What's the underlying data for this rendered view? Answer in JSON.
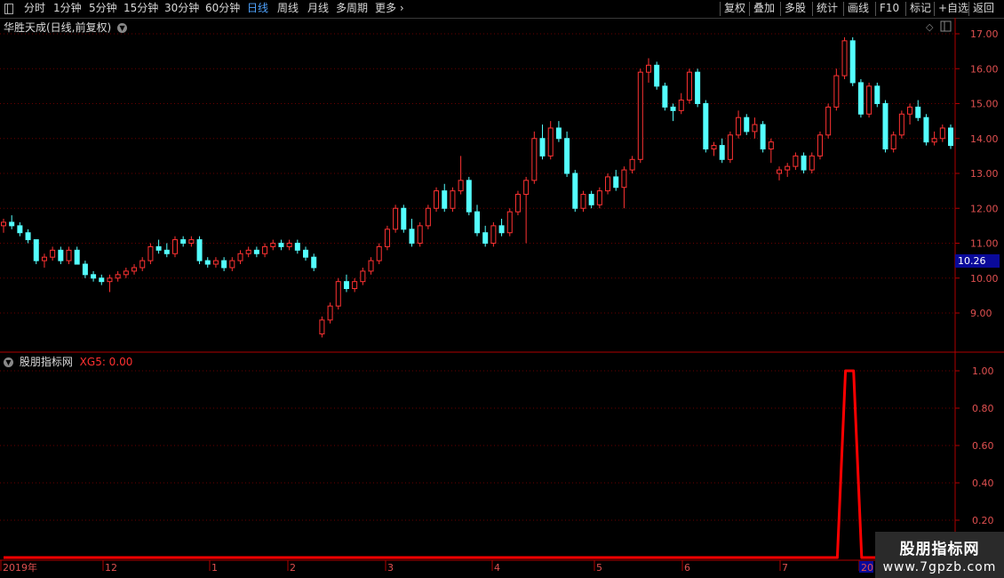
{
  "toolbar": {
    "left_items": [
      "分时",
      "1分钟",
      "5分钟",
      "15分钟",
      "30分钟",
      "60分钟",
      "日线",
      "周线",
      "月线",
      "多周期",
      "更多"
    ],
    "active": "日线",
    "right_items": [
      "复权",
      "叠加",
      "多股",
      "统计",
      "画线",
      "F10",
      "标记",
      "+自选",
      "返回"
    ]
  },
  "main_panel": {
    "title": "华胜天成(日线,前复权)",
    "current_price_label": "10.26",
    "y_ticks": [
      "17.00",
      "16.00",
      "15.00",
      "14.00",
      "13.00",
      "12.00",
      "11.00",
      "10.00",
      "9.00"
    ]
  },
  "indicator_panel": {
    "title": "股朋指标网",
    "series_label": "XG5: 0.00",
    "y_ticks": [
      "1.00",
      "0.80",
      "0.60",
      "0.40",
      "0.20"
    ]
  },
  "date_axis": {
    "labels": [
      "2019年",
      "12",
      "1",
      "2",
      "3",
      "4",
      "5",
      "6",
      "7",
      "20"
    ]
  },
  "watermark": {
    "line1": "股朋指标网",
    "line2": "www.7gpzb.com"
  },
  "chart_data": [
    {
      "type": "candlestick",
      "title": "华胜天成(日线,前复权)",
      "ylim": [
        8.0,
        17.3
      ],
      "last_value": 10.26,
      "ohlc": [
        [
          11.5,
          11.7,
          11.3,
          11.6
        ],
        [
          11.6,
          11.8,
          11.4,
          11.5
        ],
        [
          11.5,
          11.6,
          11.2,
          11.3
        ],
        [
          11.3,
          11.4,
          11.0,
          11.1
        ],
        [
          11.1,
          11.1,
          10.4,
          10.5
        ],
        [
          10.5,
          10.7,
          10.3,
          10.6
        ],
        [
          10.6,
          10.9,
          10.5,
          10.8
        ],
        [
          10.8,
          10.9,
          10.4,
          10.5
        ],
        [
          10.5,
          10.9,
          10.4,
          10.8
        ],
        [
          10.8,
          10.9,
          10.4,
          10.4
        ],
        [
          10.4,
          10.5,
          10.0,
          10.1
        ],
        [
          10.1,
          10.2,
          9.9,
          10.0
        ],
        [
          10.0,
          10.1,
          9.8,
          9.9
        ],
        [
          9.9,
          10.1,
          9.6,
          10.0
        ],
        [
          10.0,
          10.2,
          9.9,
          10.1
        ],
        [
          10.1,
          10.3,
          10.0,
          10.2
        ],
        [
          10.2,
          10.4,
          10.1,
          10.3
        ],
        [
          10.3,
          10.6,
          10.2,
          10.5
        ],
        [
          10.5,
          11.0,
          10.4,
          10.9
        ],
        [
          10.9,
          11.1,
          10.7,
          10.8
        ],
        [
          10.8,
          11.0,
          10.6,
          10.7
        ],
        [
          10.7,
          11.2,
          10.6,
          11.1
        ],
        [
          11.1,
          11.2,
          10.9,
          11.0
        ],
        [
          11.0,
          11.2,
          10.9,
          11.1
        ],
        [
          11.1,
          11.2,
          10.4,
          10.5
        ],
        [
          10.5,
          10.6,
          10.3,
          10.4
        ],
        [
          10.4,
          10.6,
          10.3,
          10.5
        ],
        [
          10.5,
          10.6,
          10.2,
          10.3
        ],
        [
          10.3,
          10.6,
          10.2,
          10.5
        ],
        [
          10.5,
          10.8,
          10.4,
          10.7
        ],
        [
          10.7,
          10.9,
          10.6,
          10.8
        ],
        [
          10.8,
          10.9,
          10.6,
          10.7
        ],
        [
          10.7,
          11.0,
          10.6,
          10.9
        ],
        [
          10.9,
          11.1,
          10.8,
          11.0
        ],
        [
          11.0,
          11.1,
          10.8,
          10.9
        ],
        [
          10.9,
          11.1,
          10.8,
          11.0
        ],
        [
          11.0,
          11.1,
          10.7,
          10.8
        ],
        [
          10.8,
          10.9,
          10.5,
          10.6
        ],
        [
          10.6,
          10.7,
          10.2,
          10.3
        ],
        [
          8.4,
          8.9,
          8.3,
          8.8
        ],
        [
          8.8,
          9.3,
          8.7,
          9.2
        ],
        [
          9.2,
          10.0,
          9.1,
          9.9
        ],
        [
          9.9,
          10.1,
          9.6,
          9.7
        ],
        [
          9.7,
          10.0,
          9.6,
          9.9
        ],
        [
          9.9,
          10.3,
          9.8,
          10.2
        ],
        [
          10.2,
          10.6,
          10.1,
          10.5
        ],
        [
          10.5,
          11.0,
          10.4,
          10.9
        ],
        [
          10.9,
          11.5,
          10.8,
          11.4
        ],
        [
          11.4,
          12.1,
          11.3,
          12.0
        ],
        [
          12.0,
          12.1,
          11.3,
          11.4
        ],
        [
          11.4,
          11.7,
          10.9,
          11.0
        ],
        [
          11.0,
          11.6,
          10.9,
          11.5
        ],
        [
          11.5,
          12.1,
          11.4,
          12.0
        ],
        [
          12.0,
          12.6,
          11.9,
          12.5
        ],
        [
          12.5,
          12.7,
          11.9,
          12.0
        ],
        [
          12.0,
          12.6,
          11.9,
          12.5
        ],
        [
          12.5,
          13.5,
          12.4,
          12.8
        ],
        [
          12.8,
          12.9,
          11.8,
          11.9
        ],
        [
          11.9,
          12.1,
          11.2,
          11.3
        ],
        [
          11.3,
          11.5,
          10.9,
          11.0
        ],
        [
          11.0,
          11.6,
          10.9,
          11.5
        ],
        [
          11.5,
          11.7,
          11.2,
          11.3
        ],
        [
          11.3,
          12.0,
          11.2,
          11.9
        ],
        [
          11.9,
          12.5,
          11.8,
          12.4
        ],
        [
          12.4,
          12.9,
          11.0,
          12.8
        ],
        [
          12.8,
          14.2,
          12.7,
          14.0
        ],
        [
          14.0,
          14.4,
          13.4,
          13.5
        ],
        [
          13.5,
          14.5,
          13.4,
          14.3
        ],
        [
          14.3,
          14.5,
          13.9,
          14.0
        ],
        [
          14.0,
          14.2,
          12.9,
          13.0
        ],
        [
          13.0,
          13.1,
          11.9,
          12.0
        ],
        [
          12.0,
          12.5,
          11.9,
          12.4
        ],
        [
          12.4,
          12.5,
          12.0,
          12.1
        ],
        [
          12.1,
          12.6,
          12.0,
          12.5
        ],
        [
          12.5,
          13.0,
          12.4,
          12.9
        ],
        [
          12.9,
          13.1,
          12.5,
          12.6
        ],
        [
          12.6,
          13.2,
          12.0,
          13.1
        ],
        [
          13.1,
          13.5,
          13.0,
          13.4
        ],
        [
          13.4,
          16.0,
          13.3,
          15.9
        ],
        [
          15.9,
          16.3,
          15.6,
          16.1
        ],
        [
          16.1,
          16.2,
          15.4,
          15.5
        ],
        [
          15.5,
          15.6,
          14.8,
          14.9
        ],
        [
          14.9,
          15.0,
          14.5,
          14.8
        ],
        [
          14.8,
          15.3,
          14.7,
          15.1
        ],
        [
          15.1,
          16.0,
          15.0,
          15.9
        ],
        [
          15.9,
          16.0,
          14.9,
          15.0
        ],
        [
          15.0,
          15.1,
          13.6,
          13.7
        ],
        [
          13.7,
          13.9,
          13.5,
          13.8
        ],
        [
          13.8,
          14.0,
          13.3,
          13.4
        ],
        [
          13.4,
          14.2,
          13.3,
          14.1
        ],
        [
          14.1,
          14.8,
          14.0,
          14.6
        ],
        [
          14.6,
          14.7,
          14.1,
          14.2
        ],
        [
          14.2,
          14.6,
          14.0,
          14.4
        ],
        [
          14.4,
          14.5,
          13.6,
          13.7
        ],
        [
          13.7,
          14.0,
          13.3,
          13.9
        ],
        [
          13.0,
          13.2,
          12.8,
          13.1
        ],
        [
          13.1,
          13.3,
          12.9,
          13.2
        ],
        [
          13.2,
          13.6,
          13.1,
          13.5
        ],
        [
          13.5,
          13.6,
          13.0,
          13.1
        ],
        [
          13.1,
          13.6,
          13.0,
          13.5
        ],
        [
          13.5,
          14.2,
          13.4,
          14.1
        ],
        [
          14.1,
          15.0,
          14.0,
          14.9
        ],
        [
          14.9,
          16.0,
          14.8,
          15.8
        ],
        [
          15.8,
          16.9,
          15.7,
          16.8
        ],
        [
          16.8,
          16.9,
          15.5,
          15.6
        ],
        [
          15.6,
          15.7,
          14.6,
          14.7
        ],
        [
          14.7,
          15.6,
          14.6,
          15.5
        ],
        [
          15.5,
          15.6,
          14.9,
          15.0
        ],
        [
          15.0,
          15.1,
          13.6,
          13.7
        ],
        [
          13.7,
          14.2,
          13.6,
          14.1
        ],
        [
          14.1,
          14.8,
          14.0,
          14.7
        ],
        [
          14.7,
          15.0,
          14.4,
          14.9
        ],
        [
          14.9,
          15.1,
          14.5,
          14.6
        ],
        [
          14.6,
          14.7,
          13.8,
          13.9
        ],
        [
          13.9,
          14.2,
          13.8,
          14.0
        ],
        [
          14.0,
          14.4,
          13.9,
          14.3
        ],
        [
          14.3,
          14.4,
          13.7,
          13.8
        ]
      ]
    },
    {
      "type": "line",
      "title": "股朋指标网",
      "series": [
        {
          "name": "XG5",
          "values": [
            0,
            0,
            0,
            0,
            0,
            0,
            0,
            0,
            0,
            0,
            0,
            0,
            0,
            0,
            0,
            0,
            0,
            0,
            0,
            0,
            0,
            0,
            0,
            0,
            0,
            0,
            0,
            0,
            0,
            0,
            0,
            0,
            0,
            0,
            0,
            0,
            0,
            0,
            0,
            0,
            0,
            0,
            0,
            0,
            0,
            0,
            0,
            0,
            0,
            0,
            0,
            0,
            0,
            0,
            0,
            0,
            0,
            0,
            0,
            0,
            0,
            0,
            0,
            0,
            0,
            0,
            0,
            0,
            0,
            0,
            0,
            0,
            0,
            0,
            0,
            0,
            0,
            0,
            0,
            0,
            0,
            0,
            0,
            0,
            0,
            0,
            0,
            0,
            0,
            0,
            0,
            0,
            0,
            0,
            0,
            0,
            0,
            0,
            0,
            0,
            0,
            0,
            0,
            0,
            1,
            1,
            0,
            0,
            0,
            0,
            0,
            0,
            0,
            0,
            0,
            0,
            0,
            0
          ]
        }
      ],
      "ylim": [
        0,
        1.05
      ],
      "color": "#ff0000"
    }
  ]
}
